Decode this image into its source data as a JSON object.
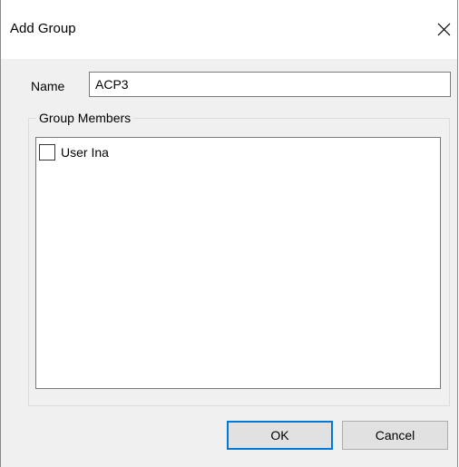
{
  "window": {
    "title": "Add Group",
    "close_icon": "close-icon"
  },
  "form": {
    "name_label": "Name",
    "name_value": "ACP3"
  },
  "group_members": {
    "legend": "Group Members",
    "items": [
      {
        "label": "User Ina",
        "checked": false
      }
    ]
  },
  "buttons": {
    "ok_label": "OK",
    "cancel_label": "Cancel"
  },
  "colors": {
    "dialog_background": "#f0f0f0",
    "title_background": "#ffffff",
    "default_button_border": "#0078d7",
    "button_background": "#e1e1e1"
  }
}
